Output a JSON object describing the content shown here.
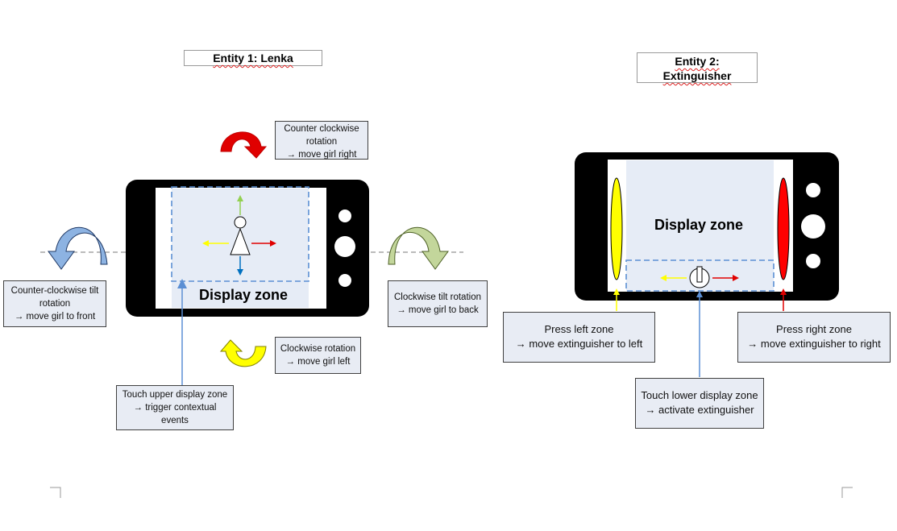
{
  "entity1": {
    "title": "Entity 1: Lenka",
    "display_zone_label": "Display zone",
    "callouts": {
      "ccw_rotation": [
        "Counter clockwise",
        "rotation",
        "→ move girl right"
      ],
      "cw_rotation": [
        "Clockwise rotation",
        "→ move girl left"
      ],
      "ccw_tilt": [
        "Counter-clockwise tilt",
        "rotation",
        "→ move girl to front"
      ],
      "cw_tilt": [
        "Clockwise tilt rotation",
        "→ move girl to back"
      ],
      "touch_upper": [
        "Touch upper display zone",
        "→ trigger contextual",
        "events"
      ]
    }
  },
  "entity2": {
    "title_line1": "Entity 2:",
    "title_line2": "Extinguisher",
    "display_zone_label": "Display zone",
    "callouts": {
      "press_left": [
        "Press left zone",
        "→ move  extinguisher to left"
      ],
      "press_right": [
        "Press right zone",
        "→ move  extinguisher to right"
      ],
      "touch_lower": [
        "Touch lower display zone",
        "→ activate extinguisher"
      ]
    }
  },
  "colors": {
    "phone_body": "#000000",
    "screen_fill": "#e6ecf6",
    "dashed_zone": "#5b8fd4",
    "red_arrow": "#e00000",
    "yellow_arrow": "#ffff00",
    "light_blue_arrow": "#8db3e2",
    "olive_arrow": "#c3d69b",
    "callout_fill": "#e8ecf4"
  }
}
